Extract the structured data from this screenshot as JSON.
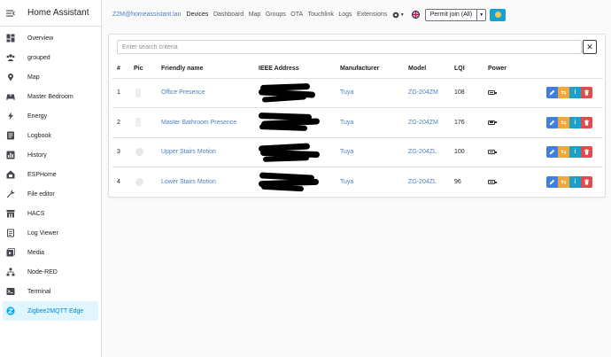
{
  "sidebar": {
    "title": "Home Assistant",
    "items": [
      {
        "label": "Overview",
        "icon": "dashboard-icon"
      },
      {
        "label": "grouped",
        "icon": "group-icon"
      },
      {
        "label": "Map",
        "icon": "map-icon"
      },
      {
        "label": "Master Bedroom",
        "icon": "bed-icon"
      },
      {
        "label": "Energy",
        "icon": "lightning-icon"
      },
      {
        "label": "Logbook",
        "icon": "logbook-icon"
      },
      {
        "label": "History",
        "icon": "history-icon"
      },
      {
        "label": "ESPHome",
        "icon": "esphome-icon"
      },
      {
        "label": "File editor",
        "icon": "wrench-icon"
      },
      {
        "label": "HACS",
        "icon": "hacs-icon"
      },
      {
        "label": "Log Viewer",
        "icon": "log-viewer-icon"
      },
      {
        "label": "Media",
        "icon": "media-icon"
      },
      {
        "label": "Node-RED",
        "icon": "node-red-icon"
      },
      {
        "label": "Terminal",
        "icon": "terminal-icon"
      },
      {
        "label": "Zigbee2MQTT Edge",
        "icon": "zigbee-icon"
      }
    ],
    "active_index": 14,
    "active_color": "#03a9f4"
  },
  "topnav": {
    "host": "Z2M@homeassistant.lan",
    "links": [
      "Devices",
      "Dashboard",
      "Map",
      "Groups",
      "OTA",
      "Touchlink",
      "Logs",
      "Extensions"
    ],
    "active": "Devices",
    "permit_join": "Permit join (All)"
  },
  "search": {
    "placeholder": "Enter search criteria",
    "value": ""
  },
  "table": {
    "headers": [
      "#",
      "Pic",
      "Friendly name",
      "IEEE Address",
      "Manufacturer",
      "Model",
      "LQI",
      "Power"
    ],
    "rows": [
      {
        "num": "1",
        "name": "Office Presence",
        "manufacturer": "Tuya",
        "model": "ZG-204ZM",
        "lqi": "108",
        "power": "battery-icon"
      },
      {
        "num": "2",
        "name": "Master Bathroom Presence",
        "manufacturer": "Tuya",
        "model": "ZG-204ZM",
        "lqi": "176",
        "power": "battery-icon"
      },
      {
        "num": "3",
        "name": "Upper Stairs Motion",
        "manufacturer": "Tuya",
        "model": "ZG-204ZL",
        "lqi": "100",
        "power": "battery-icon"
      },
      {
        "num": "4",
        "name": "Lower Stairs Motion",
        "manufacturer": "Tuya",
        "model": "ZG-204ZL",
        "lqi": "96",
        "power": "battery-icon"
      }
    ]
  },
  "colors": {
    "link": "#4a7fc1",
    "edit": "#3f7fe0",
    "swap": "#f0a83a",
    "info": "#1aa0c9",
    "delete": "#e04b4b"
  }
}
